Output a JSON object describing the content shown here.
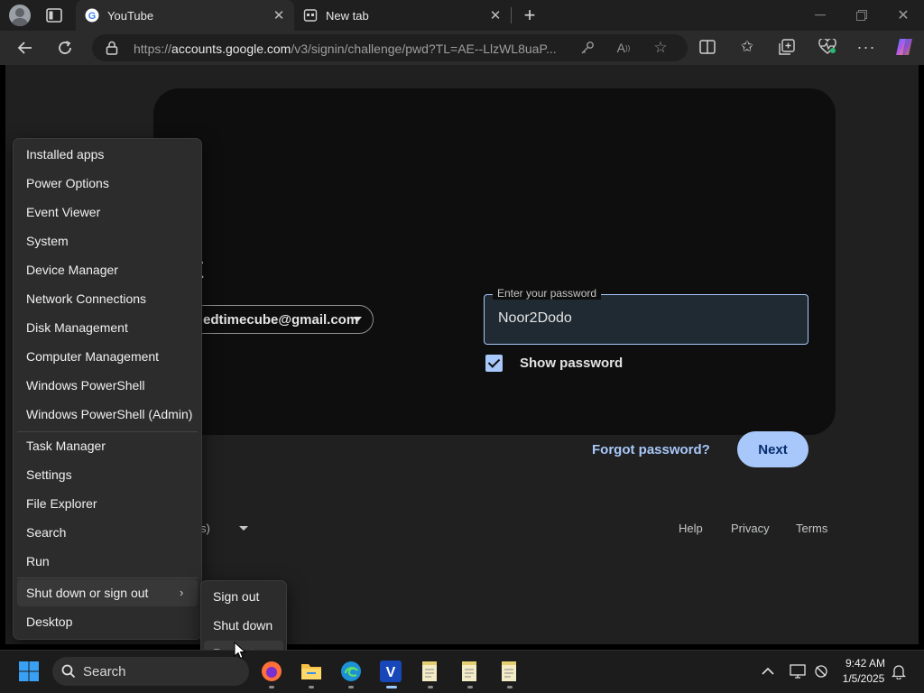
{
  "browser": {
    "tabs": [
      {
        "title": "YouTube",
        "favicon": "google-g-icon",
        "active": true
      },
      {
        "title": "New tab",
        "favicon": "new-tab-icon",
        "active": false
      }
    ],
    "url_prefix": "https://",
    "url_host": "accounts.google.com",
    "url_path": "/v3/signin/challenge/pwd?TL=AE--LlzWL8uaP..."
  },
  "signin": {
    "heading_fragment": "t",
    "account_email": "edtimecube@gmail.com",
    "password_label": "Enter your password",
    "password_value": "Noor2Dodo",
    "show_password_label": "Show password",
    "show_password_checked": true,
    "forgot_password": "Forgot password?",
    "next_label": "Next",
    "language_fragment": "s)",
    "footer": {
      "help": "Help",
      "privacy": "Privacy",
      "terms": "Terms"
    },
    "colors": {
      "accent": "#a8c7fa",
      "card": "#0e0e0e"
    }
  },
  "winx_menu": {
    "group1": [
      "Installed apps",
      "Power Options",
      "Event Viewer",
      "System",
      "Device Manager",
      "Network Connections",
      "Disk Management",
      "Computer Management",
      "Windows PowerShell",
      "Windows PowerShell (Admin)"
    ],
    "group2": [
      "Task Manager",
      "Settings",
      "File Explorer",
      "Search",
      "Run"
    ],
    "shutdown_label": "Shut down or sign out",
    "desktop_label": "Desktop",
    "submenu": [
      "Sign out",
      "Shut down",
      "Restart"
    ]
  },
  "taskbar": {
    "search_label": "Search",
    "time": "9:42 AM",
    "date": "1/5/2025",
    "apps": [
      "firefox-icon",
      "file-explorer-icon",
      "edge-icon",
      "v-app-icon",
      "notepad-icon",
      "notepad-icon",
      "notepad-icon"
    ]
  }
}
